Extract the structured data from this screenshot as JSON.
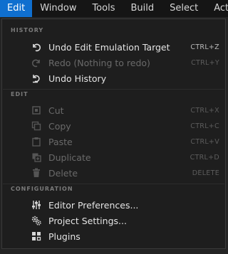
{
  "menubar": {
    "items": [
      {
        "label": "Edit"
      },
      {
        "label": "Window"
      },
      {
        "label": "Tools"
      },
      {
        "label": "Build"
      },
      {
        "label": "Select"
      },
      {
        "label": "Acto"
      }
    ]
  },
  "dropdown": {
    "history": {
      "header": "HISTORY",
      "undo": {
        "label": "Undo Edit Emulation Target",
        "shortcut": "CTRL+Z",
        "icon": "undo-icon"
      },
      "redo": {
        "label": "Redo (Nothing to redo)",
        "shortcut": "CTRL+Y",
        "icon": "redo-icon"
      },
      "undo_history": {
        "label": "Undo History",
        "icon": "undo-history-icon"
      }
    },
    "edit": {
      "header": "EDIT",
      "cut": {
        "label": "Cut",
        "shortcut": "CTRL+X",
        "icon": "cut-icon"
      },
      "copy": {
        "label": "Copy",
        "shortcut": "CTRL+C",
        "icon": "copy-icon"
      },
      "paste": {
        "label": "Paste",
        "shortcut": "CTRL+V",
        "icon": "paste-icon"
      },
      "duplicate": {
        "label": "Duplicate",
        "shortcut": "CTRL+D",
        "icon": "duplicate-icon"
      },
      "delete": {
        "label": "Delete",
        "shortcut": "DELETE",
        "icon": "trash-icon"
      }
    },
    "configuration": {
      "header": "CONFIGURATION",
      "editor_prefs": {
        "label": "Editor Preferences...",
        "icon": "sliders-icon"
      },
      "project_settings": {
        "label": "Project Settings...",
        "icon": "gears-icon"
      },
      "plugins": {
        "label": "Plugins",
        "icon": "plug-icon"
      }
    }
  },
  "colors": {
    "accent": "#0f6fcf",
    "background": "#1e1e1e",
    "menubar": "#151515",
    "text": "#e4e4e4",
    "disabled_text": "#6a6a6a"
  }
}
